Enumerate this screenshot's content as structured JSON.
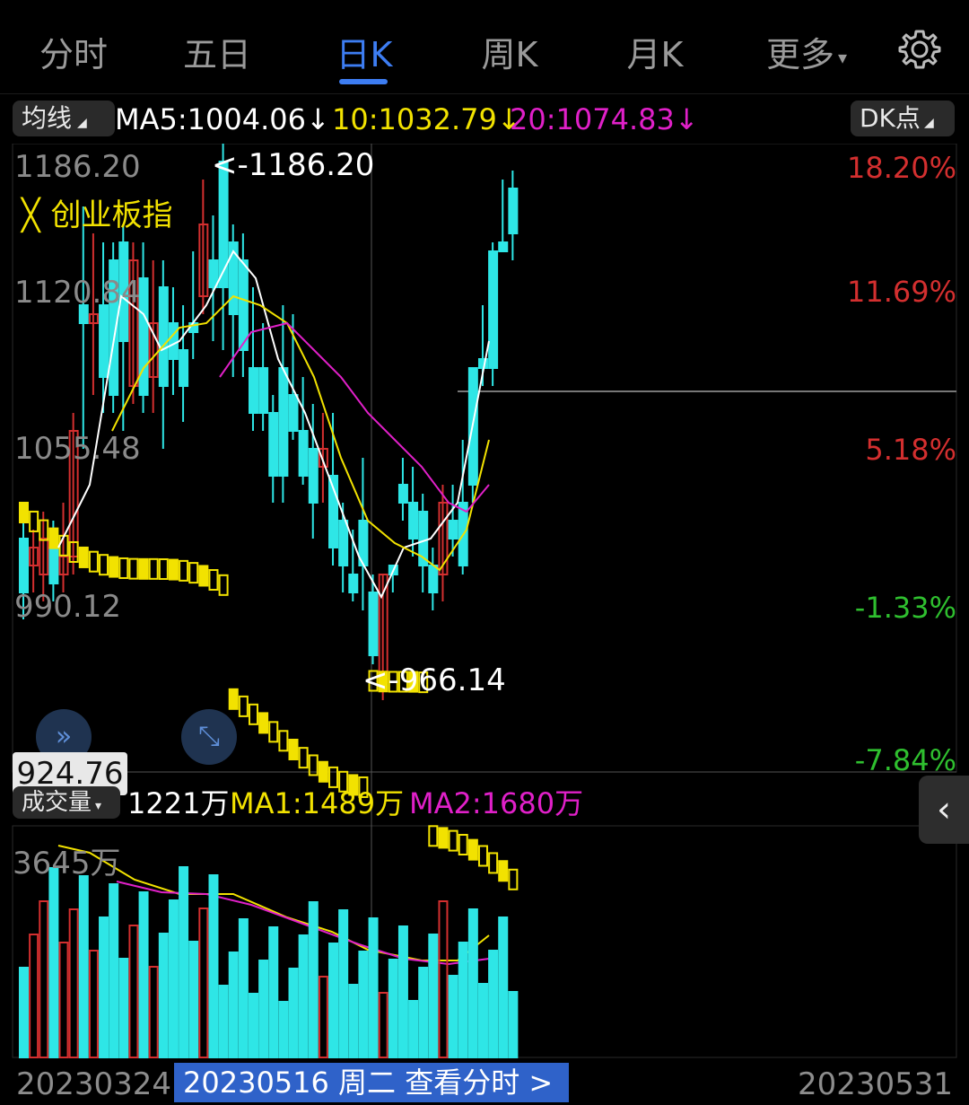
{
  "tabs": [
    "分时",
    "五日",
    "日K",
    "周K",
    "月K",
    "更多"
  ],
  "active_tab": "日K",
  "ma_bar": {
    "selector_label": "均线",
    "ma5": "MA5:1004.06↓",
    "ma10": "10:1032.79↓",
    "ma20": "20:1074.83↓",
    "dk_label": "DK点"
  },
  "price_axis": {
    "labels": [
      "1186.20",
      "1120.84",
      "1055.48",
      "990.12"
    ],
    "bottom_partial": "924.76",
    "cursor_value": "924.76"
  },
  "percent_axis": [
    "18.20%",
    "11.69%",
    "5.18%",
    "-1.33%",
    "-7.84%"
  ],
  "annotations": {
    "high": "<-1186.20",
    "low": "<-966.14",
    "overlay_index": "创业板指"
  },
  "volume": {
    "selector_label": "成交量",
    "value": "1221万",
    "ma1": "MA1:1489万",
    "ma2": "MA2:1680万",
    "axis_max": "3645万"
  },
  "dates": {
    "start": "20230324",
    "selected": "20230516 周二 查看分时 >",
    "end": "20230531"
  },
  "colors": {
    "up": "#d32f2f",
    "down": "#2ee6e6",
    "ma5": "#ffffff",
    "ma10": "#f2e200",
    "ma20": "#e020c8",
    "accent": "#3d7df2",
    "overlay": "#f2e200"
  }
}
